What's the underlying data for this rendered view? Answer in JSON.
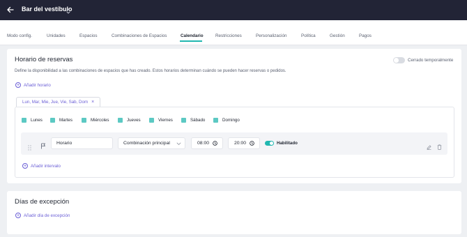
{
  "header": {
    "venue_name": "Bar del vestíbulo"
  },
  "tabs": [
    {
      "label": "Modo config."
    },
    {
      "label": "Unidades"
    },
    {
      "label": "Espacios"
    },
    {
      "label": "Combinaciones de Espacios"
    },
    {
      "label": "Calendario",
      "active": true
    },
    {
      "label": "Restricciones"
    },
    {
      "label": "Personalización"
    },
    {
      "label": "Política"
    },
    {
      "label": "Gestión"
    },
    {
      "label": "Pagos"
    }
  ],
  "schedule": {
    "title": "Horario de reservas",
    "description": "Define la disponibilidad a las combinaciones de espacios que has creado. Estos horarios determinan cuándo se pueden hacer reservas o pedidos.",
    "temporarily_closed_label": "Cerrado temporalmente",
    "add_schedule_label": "Añadir horario",
    "days_chip": "Lun, Mar, Mie, Jue, Vie, Sab, Dom",
    "days": [
      {
        "label": "Lunes",
        "checked": true
      },
      {
        "label": "Martes",
        "checked": true
      },
      {
        "label": "Miércoles",
        "checked": true
      },
      {
        "label": "Jueves",
        "checked": true
      },
      {
        "label": "Viernes",
        "checked": true
      },
      {
        "label": "Sábado",
        "checked": true
      },
      {
        "label": "Domingo",
        "checked": true
      }
    ],
    "interval": {
      "name": "Horario",
      "combination": "Combinación principal",
      "start_time": "08:00",
      "end_time": "20:00",
      "enabled_label": "Habilitado"
    },
    "add_interval_label": "Añadir intervalo"
  },
  "exceptions": {
    "title": "Días de excepción",
    "add_label": "Añadir día de excepción"
  },
  "colors": {
    "header_bg": "#222436",
    "accent_teal": "#21b7b0",
    "link_purple": "#6b5fd6"
  }
}
